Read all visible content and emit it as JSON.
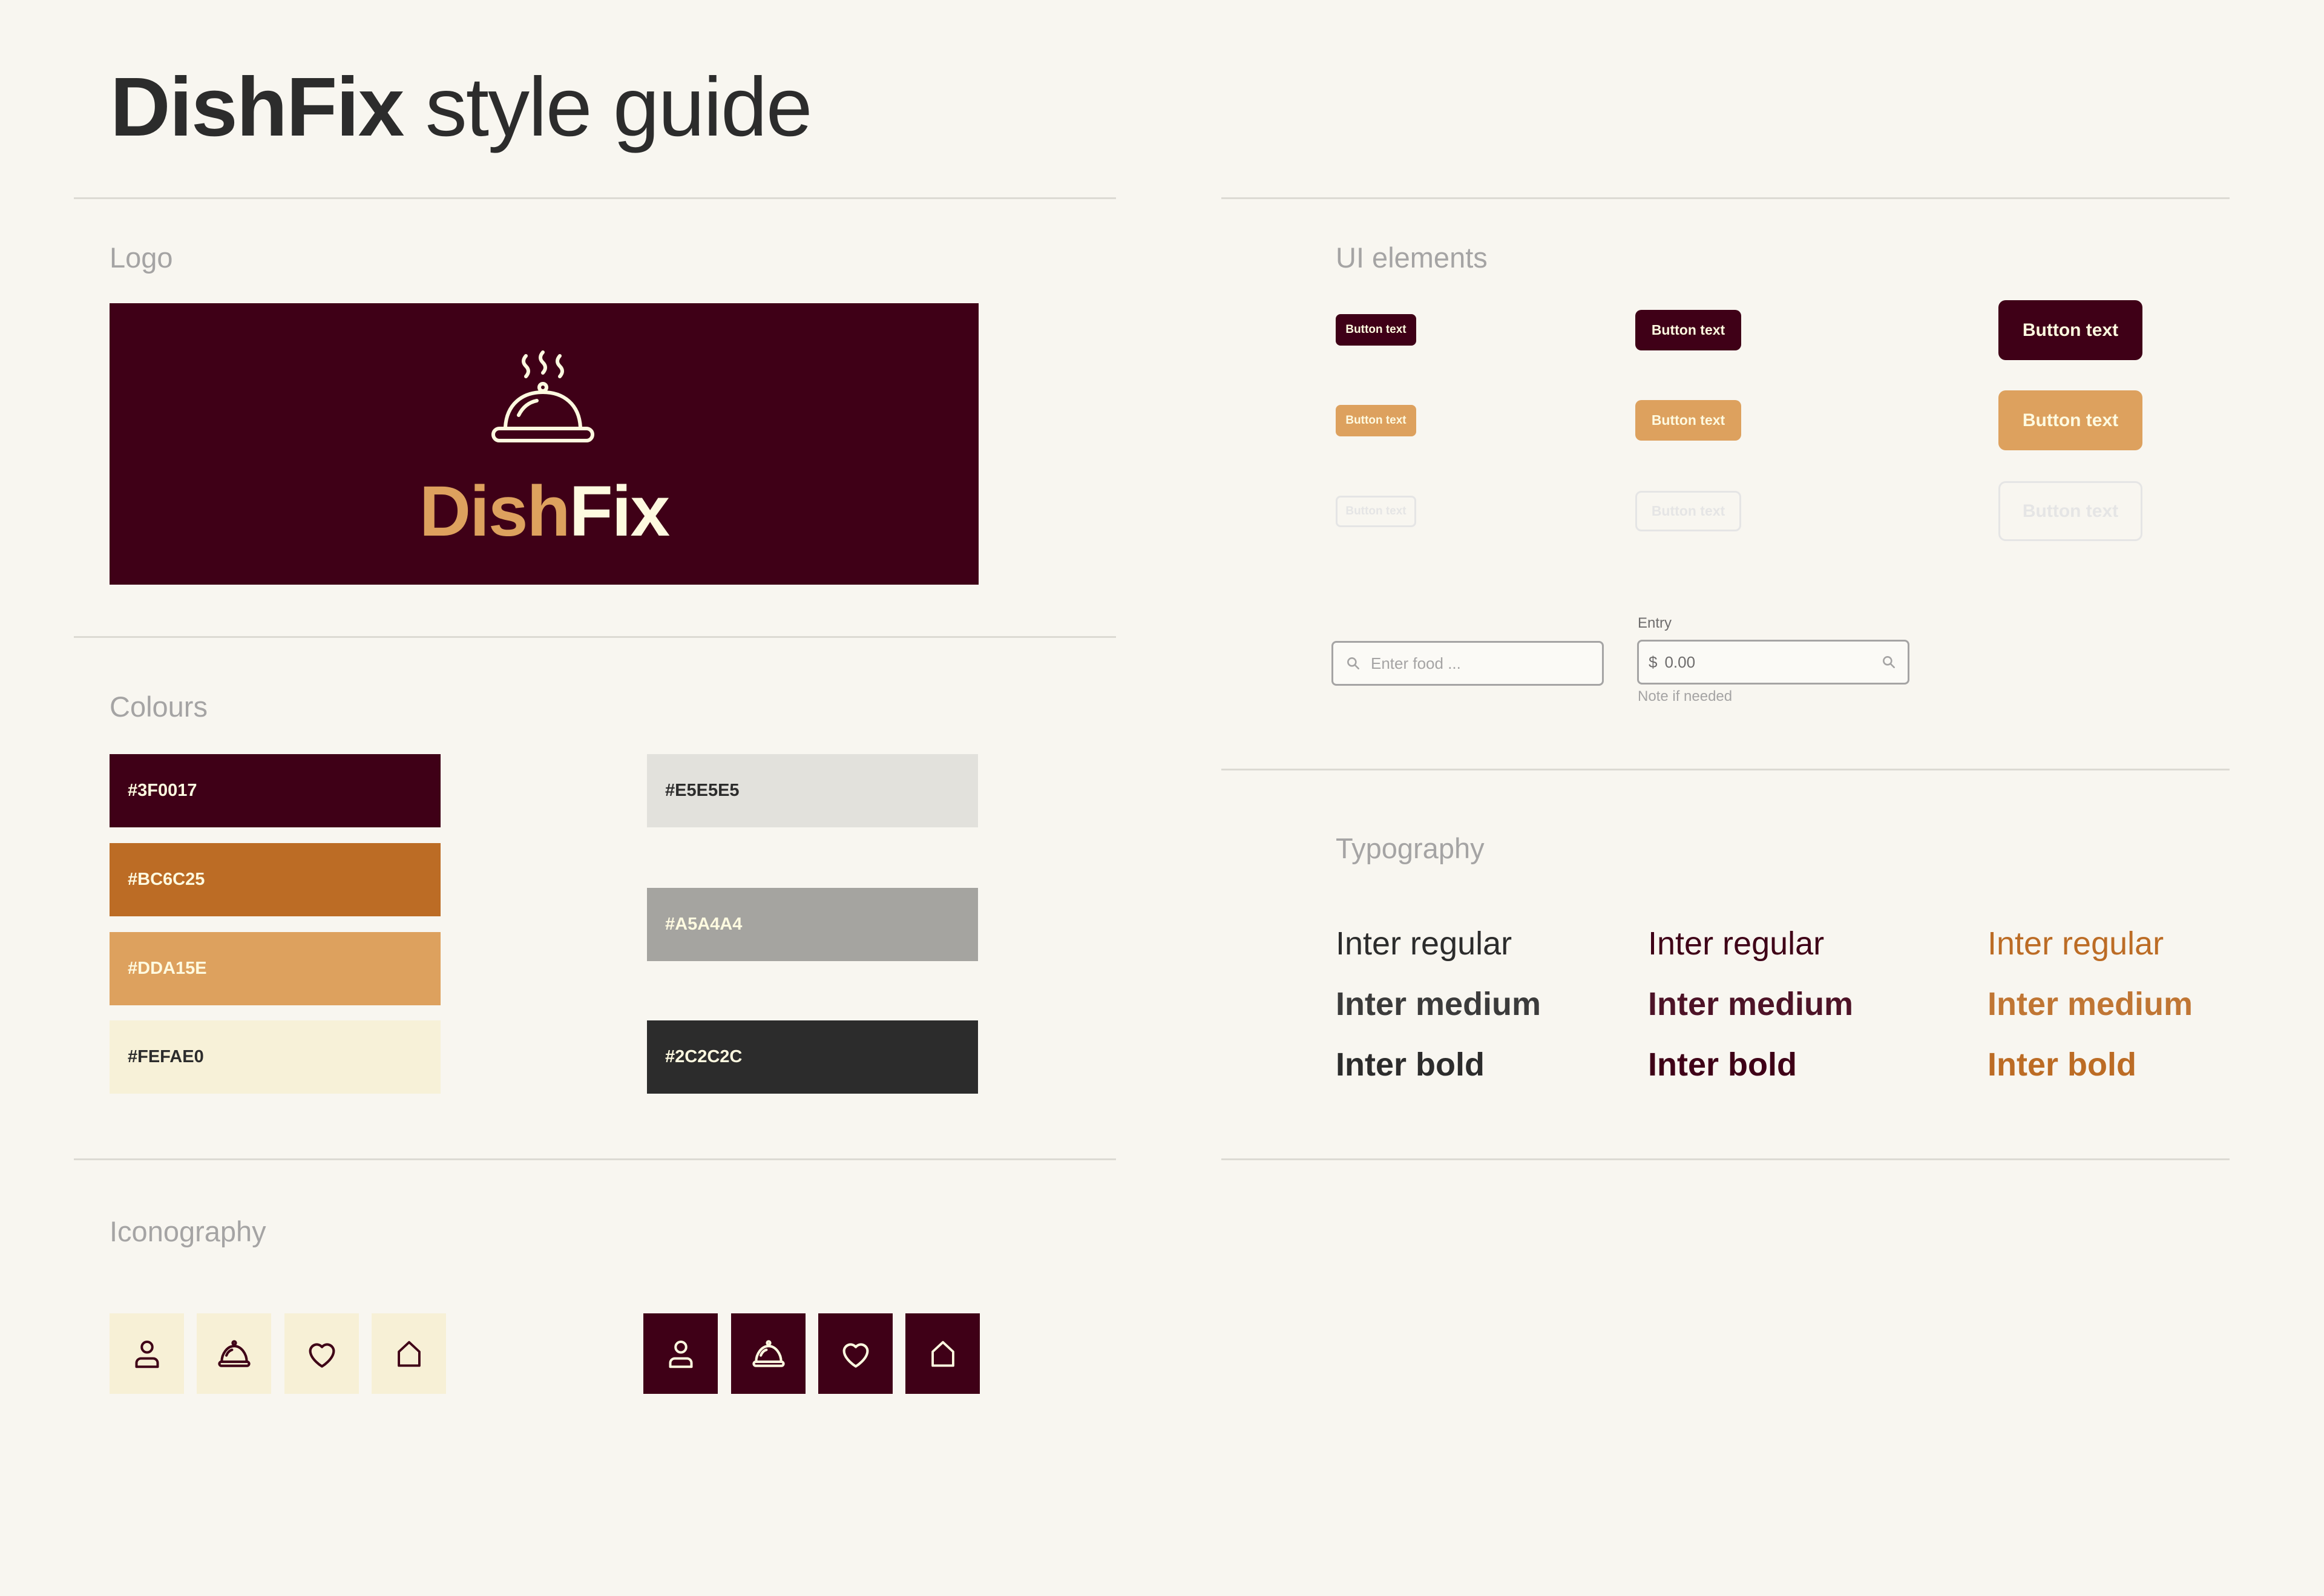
{
  "header": {
    "brand": "DishFix",
    "rest": " style guide"
  },
  "sections": {
    "logo": "Logo",
    "colours": "Colours",
    "iconography": "Iconography",
    "ui_elements": "UI elements",
    "typography": "Typography"
  },
  "logo": {
    "word_dish": "Dish",
    "word_fix": "Fix",
    "icon": "cloche-icon"
  },
  "colours": {
    "left": [
      {
        "hex": "#3F0017",
        "color": "#3F0017",
        "text_color": "#FEFAE0"
      },
      {
        "hex": "#BC6C25",
        "color": "#BC6C25",
        "text_color": "#FEFAE0"
      },
      {
        "hex": "#DDA15E",
        "color": "#DDA15E",
        "text_color": "#FEFAE0"
      },
      {
        "hex": "#FEFAE0",
        "color": "#F7F1D8",
        "text_color": "#2C2C2C"
      }
    ],
    "right": [
      {
        "hex": "#E5E5E5",
        "color": "#E2E1DC",
        "text_color": "#2C2C2C"
      },
      {
        "hex": "#A5A4A4",
        "color": "#A5A4A0",
        "text_color": "#FEFAE0"
      },
      {
        "hex": "#2C2C2C",
        "color": "#2C2C2C",
        "text_color": "#FEFAE0"
      }
    ]
  },
  "buttons": {
    "label": "Button text",
    "variants": [
      "primary",
      "secondary",
      "ghost"
    ],
    "sizes": [
      "small",
      "medium",
      "large"
    ]
  },
  "inputs": {
    "search": {
      "placeholder": "Enter food ...",
      "icon": "search-icon"
    },
    "entry": {
      "label": "Entry",
      "currency": "$",
      "value": "0.00",
      "note": "Note if needed",
      "icon": "search-icon"
    }
  },
  "typography": {
    "samples": [
      "Inter regular",
      "Inter medium",
      "Inter bold"
    ],
    "column_colors": [
      "#2C2C2C",
      "#3F0017",
      "#BC6C25"
    ]
  },
  "icons": {
    "names": [
      "person-icon",
      "cloche-icon",
      "heart-icon",
      "home-icon"
    ],
    "light_stroke": "#3F0017",
    "dark_stroke": "#FEFAE0"
  }
}
